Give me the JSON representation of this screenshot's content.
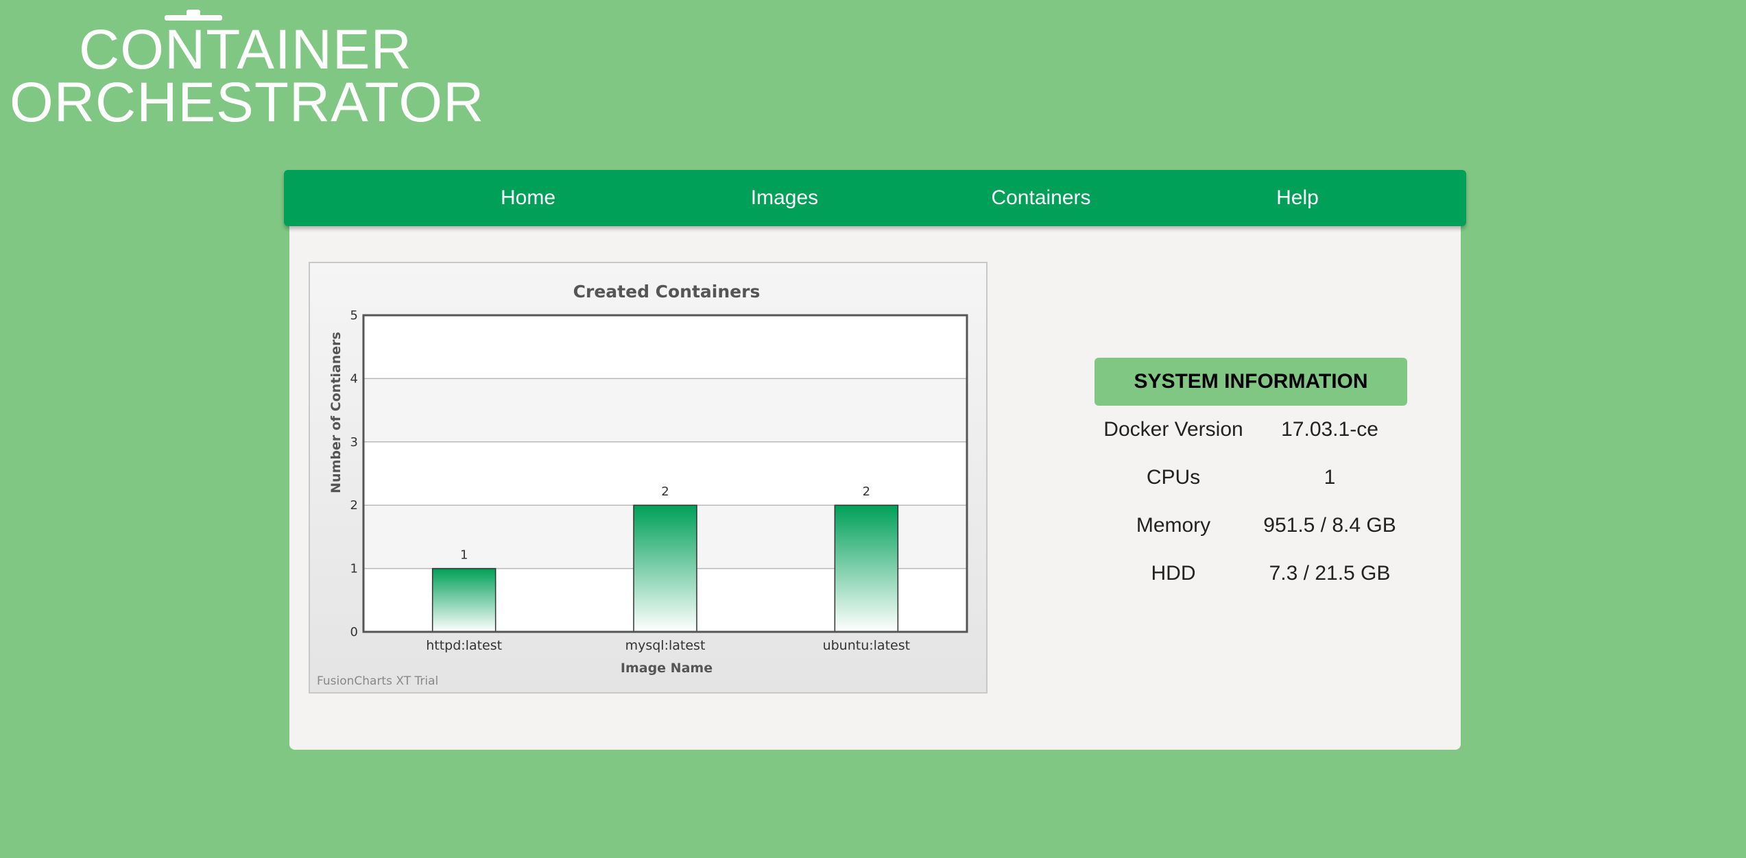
{
  "logo": {
    "line1": "CONTAINER",
    "line2": "ORCHESTRATOR"
  },
  "nav": {
    "items": [
      {
        "label": "Home"
      },
      {
        "label": "Images"
      },
      {
        "label": "Containers"
      },
      {
        "label": "Help"
      }
    ]
  },
  "chart_data": {
    "type": "bar",
    "title": "Created Containers",
    "xlabel": "Image Name",
    "ylabel": "Number of Contianers",
    "categories": [
      "httpd:latest",
      "mysql:latest",
      "ubuntu:latest"
    ],
    "values": [
      1,
      2,
      2
    ],
    "ylim": [
      0,
      5
    ],
    "yticks": [
      0,
      1,
      2,
      3,
      4,
      5
    ],
    "grid": true,
    "legend": "none",
    "bar_color": "#00a058",
    "watermark": "FusionCharts XT Trial"
  },
  "system_info": {
    "title": "SYSTEM INFORMATION",
    "rows": [
      {
        "label": "Docker Version",
        "value": "17.03.1-ce"
      },
      {
        "label": "CPUs",
        "value": "1"
      },
      {
        "label": "Memory",
        "value": "951.5 / 8.4 GB"
      },
      {
        "label": "HDD",
        "value": "7.3 / 21.5 GB"
      }
    ]
  },
  "colors": {
    "background": "#80c784",
    "nav": "#00a058",
    "panel": "#f4f3f1",
    "sys_header": "#80c784"
  }
}
